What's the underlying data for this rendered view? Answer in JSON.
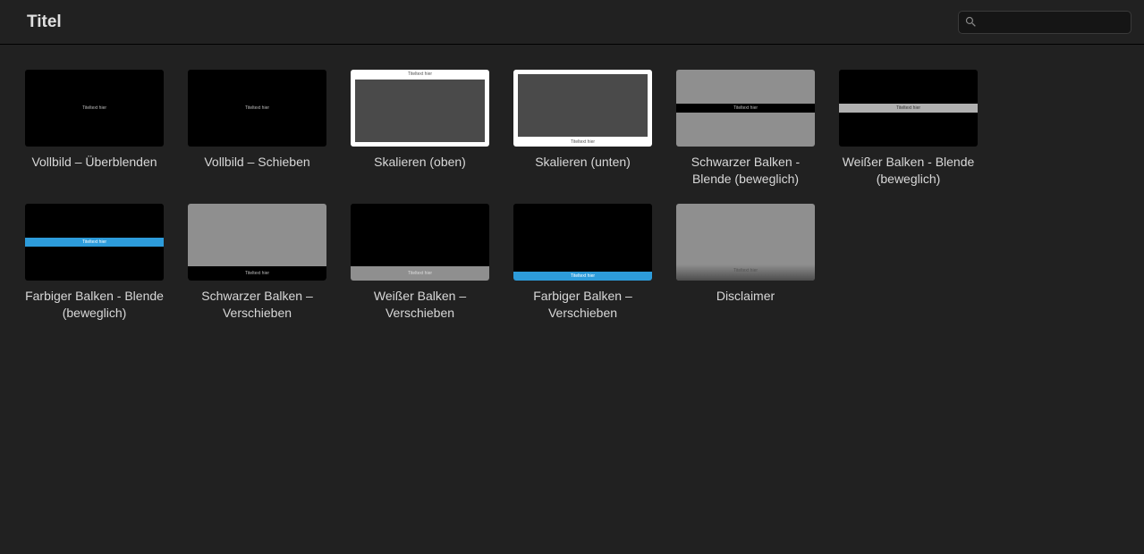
{
  "header": {
    "title": "Titel",
    "search_placeholder": ""
  },
  "thumb_text": "Titeltext hier",
  "items": [
    {
      "label": "Vollbild – Überblenden",
      "variant": "th-full-black"
    },
    {
      "label": "Vollbild – Schieben",
      "variant": "th-full-black"
    },
    {
      "label": "Skalieren (oben)",
      "variant": "th-scale-top"
    },
    {
      "label": "Skalieren (unten)",
      "variant": "th-scale-bot"
    },
    {
      "label": "Schwarzer Balken - Blende (beweglich)",
      "variant": "th-black-bar"
    },
    {
      "label": "Weißer Balken - Blende (beweglich)",
      "variant": "th-white-bar"
    },
    {
      "label": "Farbiger Balken - Blende (beweglich)",
      "variant": "th-color-bar"
    },
    {
      "label": "Schwarzer Balken – Verschieben",
      "variant": "th-black-bar-slide"
    },
    {
      "label": "Weißer Balken – Verschieben",
      "variant": "th-white-bar-slide"
    },
    {
      "label": "Farbiger Balken – Verschieben",
      "variant": "th-color-bar-slide"
    },
    {
      "label": "Disclaimer",
      "variant": "th-disclaimer"
    }
  ]
}
